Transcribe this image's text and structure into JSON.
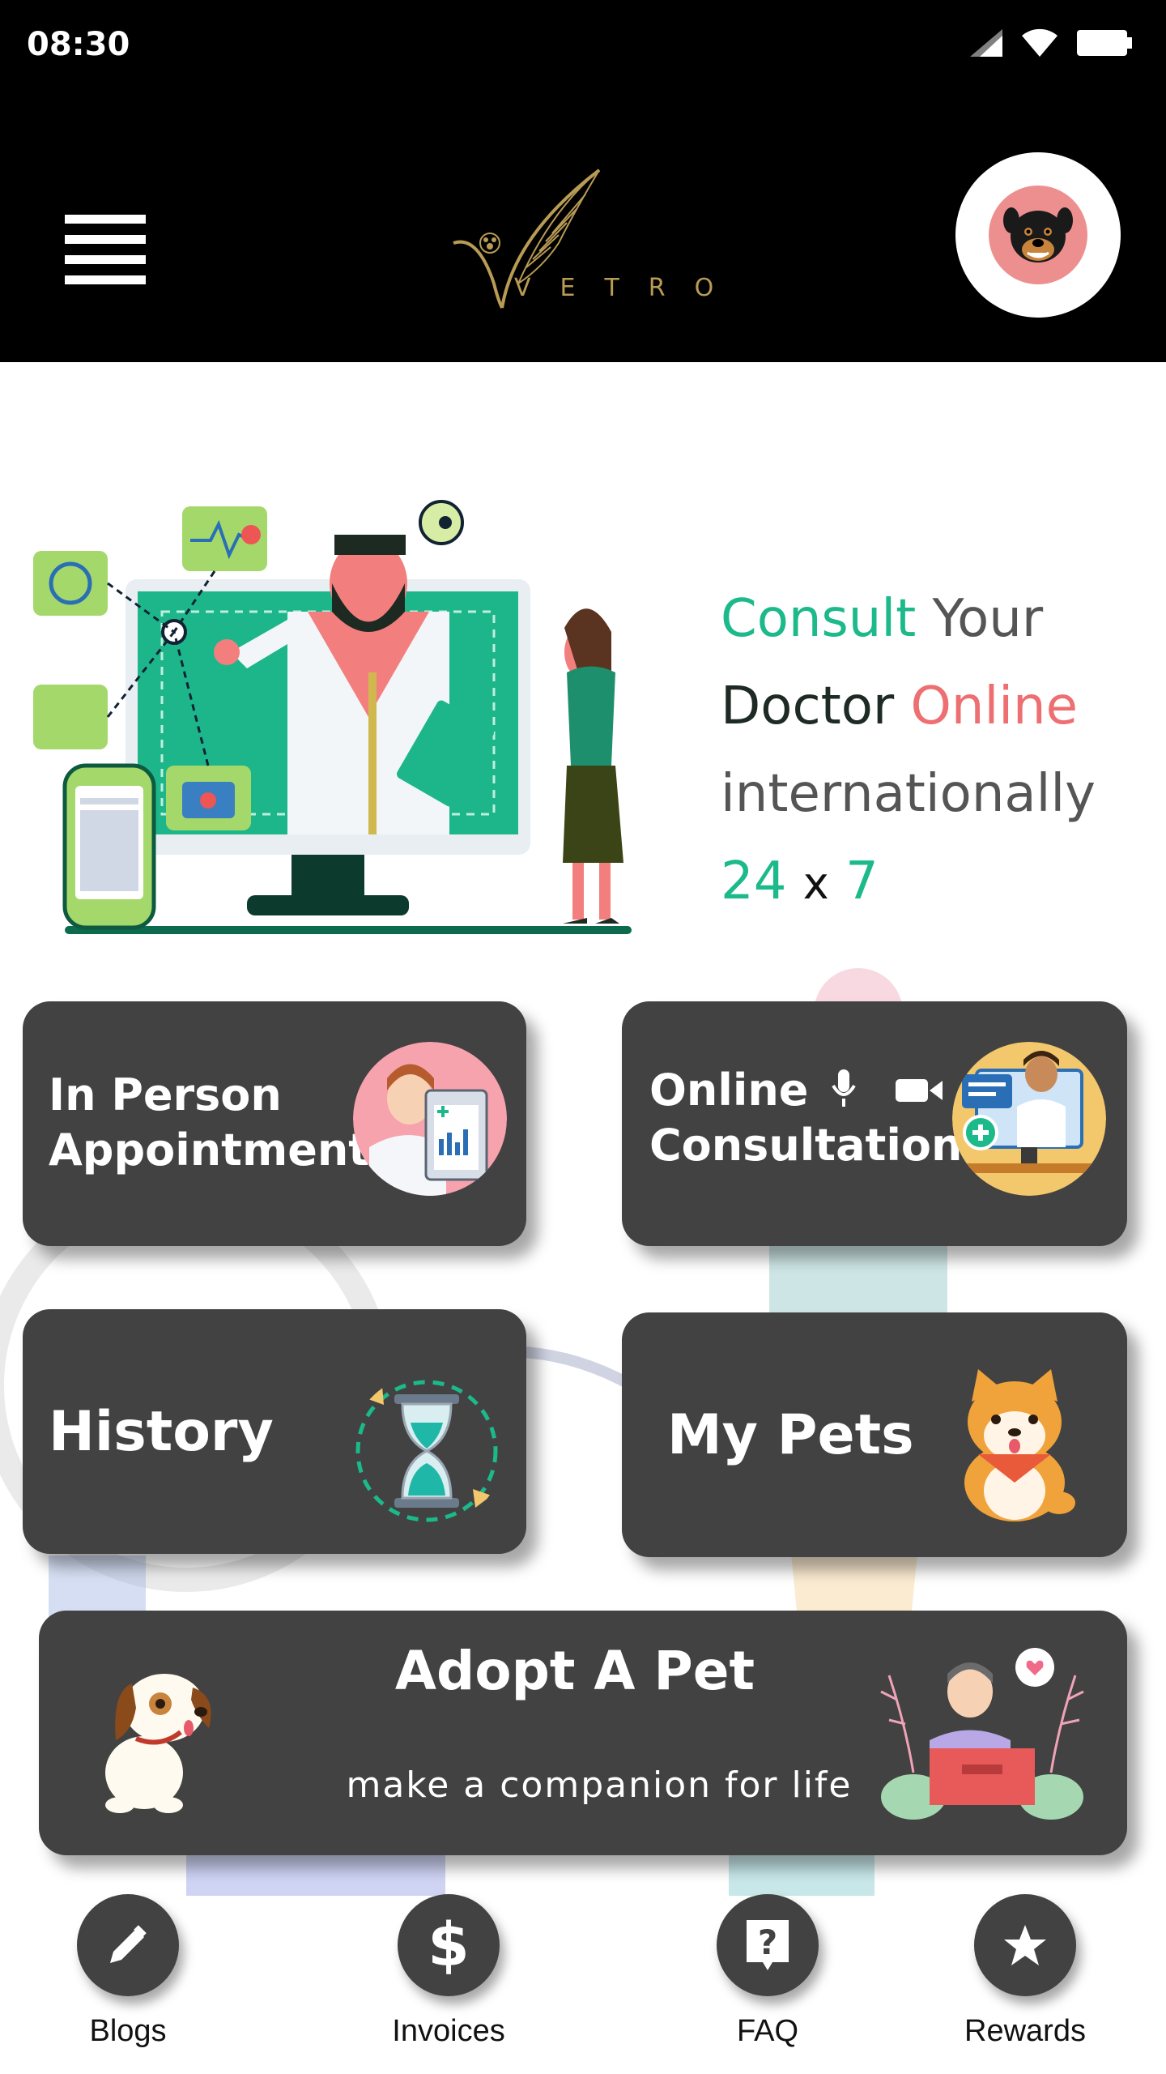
{
  "status_bar": {
    "time": "08:30"
  },
  "header": {
    "logo_text": "VETRO"
  },
  "hero": {
    "line1": {
      "part1": "Consult",
      "part2": "Your"
    },
    "line2": {
      "part1": "Doctor",
      "part2": "Online"
    },
    "line3": "internationally",
    "line4": {
      "part1": "24",
      "part2": "x",
      "part3": "7"
    }
  },
  "cards": {
    "in_person": {
      "line1": "In Person",
      "line2": "Appointment"
    },
    "online": {
      "line1": "Online",
      "line2": "Consultation"
    },
    "history": {
      "label": "History"
    },
    "my_pets": {
      "label": "My Pets"
    },
    "adopt": {
      "title": "Adopt A Pet",
      "subtitle": "make a companion for life"
    }
  },
  "bottom_nav": [
    {
      "label": "Blogs",
      "icon": "pencil-icon"
    },
    {
      "label": "Invoices",
      "icon": "dollar-icon"
    },
    {
      "label": "FAQ",
      "icon": "question-icon"
    },
    {
      "label": "Rewards",
      "icon": "star-icon"
    }
  ],
  "colors": {
    "accent_green": "#1cb98a",
    "accent_pink": "#ee6f72",
    "card_bg": "#424242",
    "header_bg": "#000000"
  }
}
